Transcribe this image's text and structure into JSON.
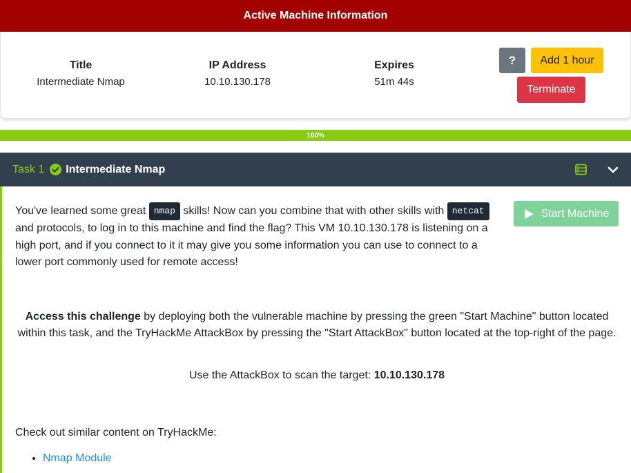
{
  "header": {
    "title": "Active Machine Information"
  },
  "machine": {
    "title_label": "Title",
    "title_value": "Intermediate Nmap",
    "ip_label": "IP Address",
    "ip_value": "10.10.130.178",
    "expires_label": "Expires",
    "expires_value": "51m 44s",
    "help_label": "?",
    "add_hour_label": "Add 1 hour",
    "terminate_label": "Terminate"
  },
  "progress": {
    "value_percent": 100,
    "label": "100%"
  },
  "task": {
    "number_label": "Task 1",
    "title": "Intermediate Nmap",
    "completed": true,
    "start_machine_label": "Start Machine",
    "intro": {
      "part1": "You've learned some great ",
      "code1": "nmap",
      "part2": " skills! Now can you combine that with other skills with ",
      "code2": "netcat",
      "part3": " and protocols, to log in to this machine and find the flag? This VM 10.10.130.178 is listening on a high port, and if you connect to it it may give you some information you can use to connect to a lower port commonly used for remote access!"
    },
    "access": {
      "bold": "Access this challenge",
      "rest": " by deploying both the vulnerable machine by pressing the green \"Start Machine\" button located within this task, and the TryHackMe AttackBox by pressing the  \"Start AttackBox\" button located at the top-right of the page."
    },
    "target": {
      "prefix": "Use the AttackBox to scan the target: ",
      "ip": "10.10.130.178"
    },
    "similar_text": "Check out similar content on TryHackMe:",
    "modules": [
      "Nmap Module"
    ]
  },
  "colors": {
    "header_red": "#a30000",
    "accent_green": "#88cc14",
    "task_header_bg": "#323f4f",
    "add_hour_yellow": "#ffc107",
    "terminate_red": "#dc3545",
    "help_gray": "#6c757d",
    "start_machine_green": "#7ed29a",
    "link_blue": "#1e88e5"
  },
  "icons": {
    "check": "check-circle-icon",
    "list": "list-icon",
    "chevron": "chevron-down-icon",
    "play": "play-icon"
  }
}
